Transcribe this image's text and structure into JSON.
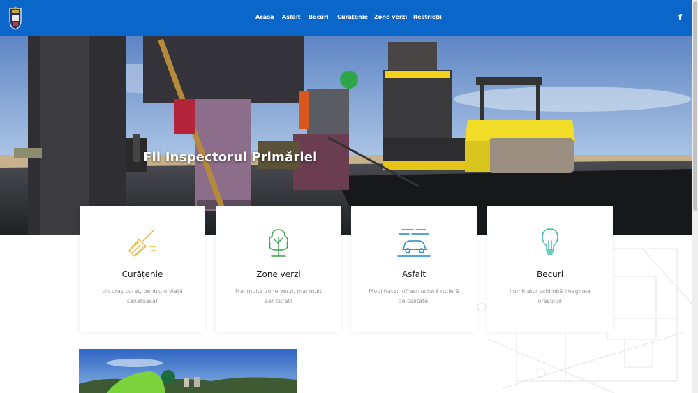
{
  "nav": {
    "items": [
      "Acasă",
      "Asfalt",
      "Becuri",
      "Curățenie",
      "Zone verzi",
      "Restricții"
    ],
    "facebook_glyph": "f"
  },
  "hero": {
    "title": "Fii Inspectorul Primăriei"
  },
  "cards": [
    {
      "title": "Curățenie",
      "text": "Un oraș curat, pentru o viață sănătoasă!",
      "icon": "broom-icon"
    },
    {
      "title": "Zone verzi",
      "text": "Mai multe zone verzi, mai mult aer curat!",
      "icon": "tree-icon"
    },
    {
      "title": "Asfalt",
      "text": "Mobilitate: Infrastructură rutieră de calitate.",
      "icon": "car-icon"
    },
    {
      "title": "Becuri",
      "text": "Iluminatul schimbă imaginea orașului!",
      "icon": "lightbulb-icon"
    }
  ],
  "colors": {
    "header": "#0a66c8",
    "broom": "#f0b429",
    "tree": "#3aa24a",
    "car": "#1e88c7",
    "bulb": "#3bb8a8"
  }
}
